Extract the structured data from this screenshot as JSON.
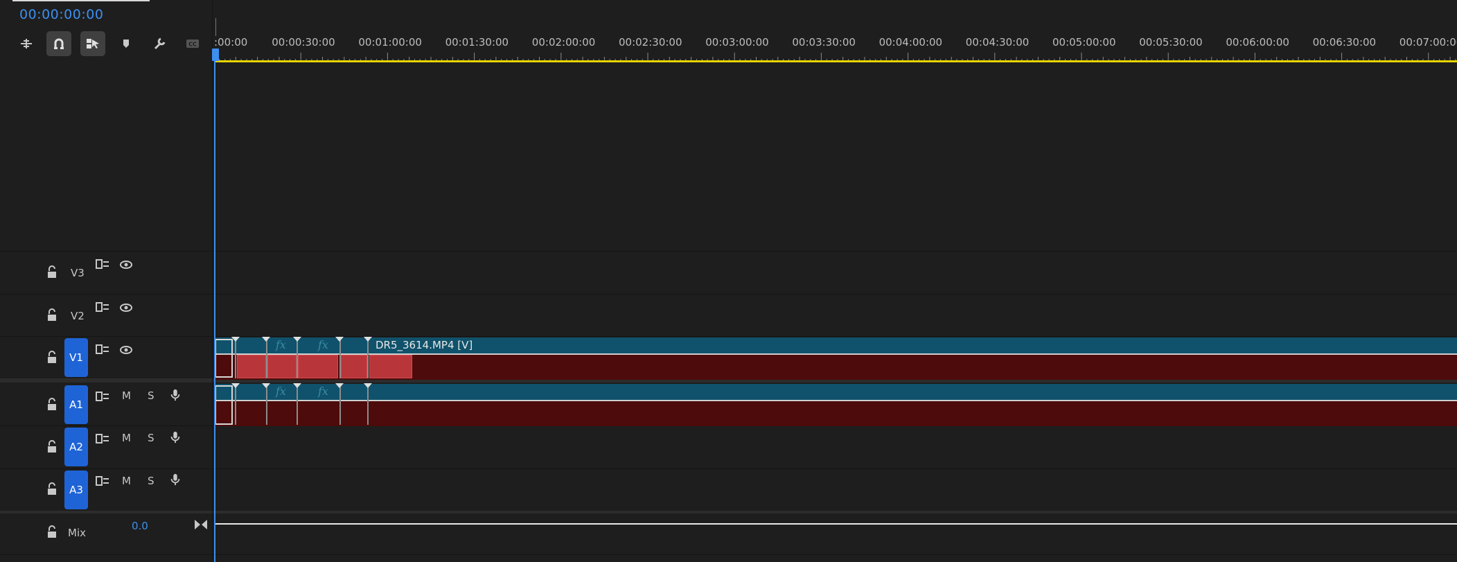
{
  "timecode": "00:00:00:00",
  "toolbar": {
    "tools": [
      {
        "name": "insert-nest-icon",
        "active": false
      },
      {
        "name": "snap-icon",
        "active": true
      },
      {
        "name": "linked-selection-icon",
        "active": true
      },
      {
        "name": "add-marker-icon",
        "active": false
      },
      {
        "name": "timeline-settings-icon",
        "active": false
      },
      {
        "name": "captions-icon",
        "active": false
      }
    ]
  },
  "ruler": {
    "labels": [
      ":00:00",
      "00:00:30:00",
      "00:01:00:00",
      "00:01:30:00",
      "00:02:00:00",
      "00:02:30:00",
      "00:03:00:00",
      "00:03:30:00",
      "00:04:00:00",
      "00:04:30:00",
      "00:05:00:00",
      "00:05:30:00",
      "00:06:00:00",
      "00:06:30:00",
      "00:07:00:00"
    ]
  },
  "tracks": {
    "v3": {
      "label": "V3"
    },
    "v2": {
      "label": "V2"
    },
    "v1": {
      "label": "V1",
      "clip_name": "DR5_3614.MP4 [V]"
    },
    "a1": {
      "label": "A1",
      "mute": "M",
      "solo": "S"
    },
    "a2": {
      "label": "A2",
      "mute": "M",
      "solo": "S"
    },
    "a3": {
      "label": "A3",
      "mute": "M",
      "solo": "S"
    },
    "mix": {
      "label": "Mix",
      "value": "0.0"
    }
  },
  "fx_badge": "fx",
  "colors": {
    "accent": "#3d8ff0",
    "work_area": "#e6d400",
    "clip_video_bar": "#10526b",
    "clip_body": "#4d0b0b",
    "target_button": "#1f64d6"
  }
}
